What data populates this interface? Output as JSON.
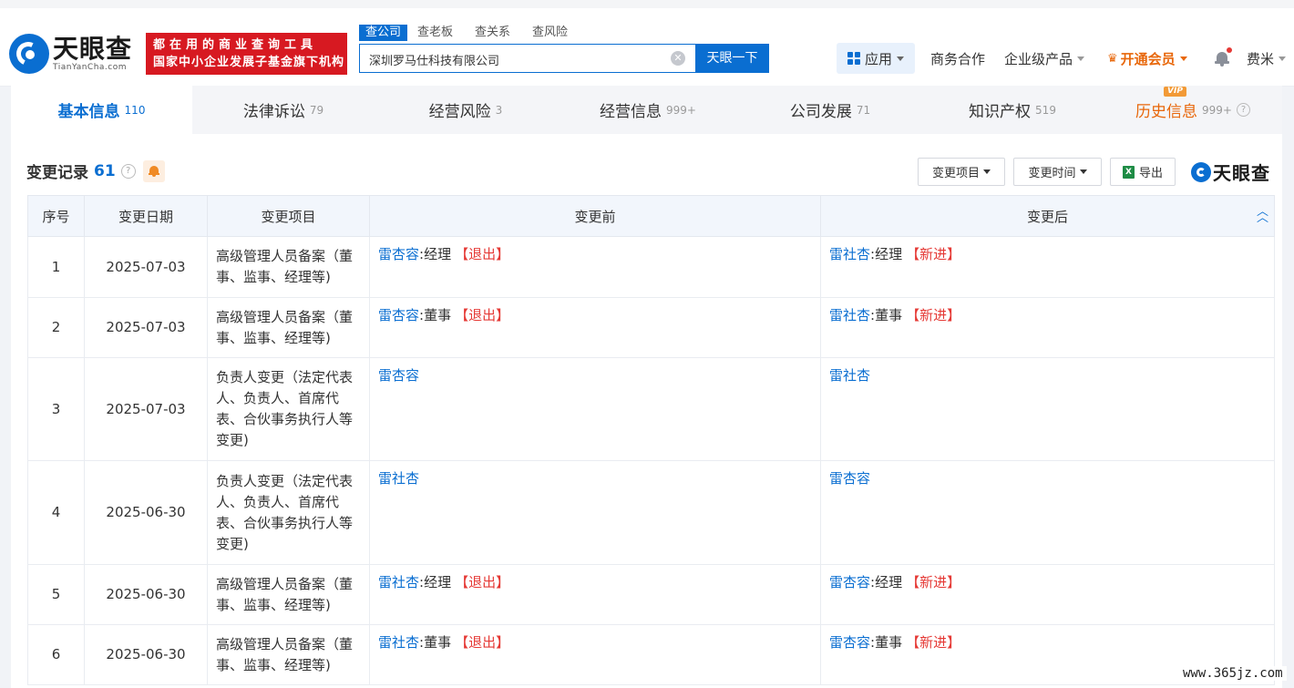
{
  "header": {
    "logo_cn": "天眼查",
    "logo_en": "TianYanCha.com",
    "slogan_line1": "都在用的商业查询工具",
    "slogan_line2": "国家中小企业发展子基金旗下机构",
    "search_tabs": [
      "查公司",
      "查老板",
      "查关系",
      "查风险"
    ],
    "search_value": "深圳罗马仕科技有限公司",
    "search_button": "天眼一下",
    "nav": {
      "apps": "应用",
      "business": "商务合作",
      "enterprise": "企业级产品",
      "vip": "开通会员",
      "user": "费米"
    }
  },
  "main_tabs": [
    {
      "label": "基本信息",
      "count": "110"
    },
    {
      "label": "法律诉讼",
      "count": "79"
    },
    {
      "label": "经营风险",
      "count": "3"
    },
    {
      "label": "经营信息",
      "count": "999+"
    },
    {
      "label": "公司发展",
      "count": "71"
    },
    {
      "label": "知识产权",
      "count": "519"
    },
    {
      "label": "历史信息",
      "count": "999+",
      "badge": "VIP"
    }
  ],
  "section": {
    "title": "变更记录",
    "count": "61",
    "filter_item": "变更项目",
    "filter_time": "变更时间",
    "export": "导出",
    "watermark_logo": "天眼查"
  },
  "table": {
    "headers": [
      "序号",
      "变更日期",
      "变更项目",
      "变更前",
      "变更后"
    ],
    "rows": [
      {
        "no": "1",
        "date": "2025-07-03",
        "item": "高级管理人员备案（董事、监事、经理等)",
        "before_name": "雷杏容",
        "before_role": ":经理",
        "before_tag": "【退出】",
        "after_name": "雷社杏",
        "after_role": ":经理",
        "after_tag": "【新进】"
      },
      {
        "no": "2",
        "date": "2025-07-03",
        "item": "高级管理人员备案（董事、监事、经理等)",
        "before_name": "雷杏容",
        "before_role": ":董事",
        "before_tag": "【退出】",
        "after_name": "雷社杏",
        "after_role": ":董事",
        "after_tag": "【新进】"
      },
      {
        "no": "3",
        "date": "2025-07-03",
        "item": "负责人变更（法定代表人、负责人、首席代表、合伙事务执行人等变更)",
        "before_name": "雷杏容",
        "after_name": "雷社杏"
      },
      {
        "no": "4",
        "date": "2025-06-30",
        "item": "负责人变更（法定代表人、负责人、首席代表、合伙事务执行人等变更)",
        "before_name": "雷社杏",
        "after_name": "雷杏容"
      },
      {
        "no": "5",
        "date": "2025-06-30",
        "item": "高级管理人员备案（董事、监事、经理等)",
        "before_name": "雷社杏",
        "before_role": ":经理",
        "before_tag": "【退出】",
        "after_name": "雷杏容",
        "after_role": ":经理",
        "after_tag": "【新进】"
      },
      {
        "no": "6",
        "date": "2025-06-30",
        "item": "高级管理人员备案（董事、监事、经理等)",
        "before_name": "雷社杏",
        "before_role": ":董事",
        "before_tag": "【退出】",
        "after_name": "雷杏容",
        "after_role": ":董事",
        "after_tag": "【新进】"
      }
    ]
  },
  "site_watermark": "www.365jz.com",
  "colors": {
    "brand_blue": "#0a6ed1",
    "slogan_red": "#d71921",
    "vip_orange": "#e8670a",
    "tag_red": "#e53935"
  }
}
